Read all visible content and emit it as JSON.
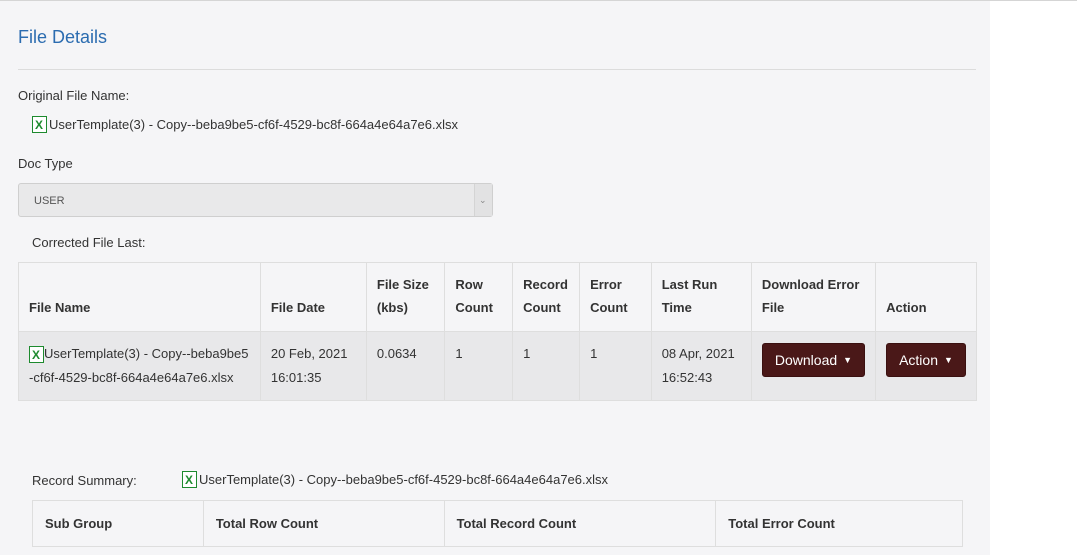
{
  "page": {
    "title": "File Details"
  },
  "original": {
    "label": "Original File Name:",
    "file_name": "UserTemplate(3) - Copy--beba9be5-cf6f-4529-bc8f-664a4e64a7e6.xlsx",
    "icon": "excel-file-icon"
  },
  "doc_type": {
    "label": "Doc Type",
    "selected": "USER",
    "icon": "chevron-down-icon"
  },
  "corrected": {
    "label": "Corrected File Last:",
    "columns": [
      "File Name",
      "File Date",
      "File Size(kbs)",
      "Row Count",
      "Record Count",
      "Error Count",
      "Last Run Time",
      "Download Error File",
      "Action"
    ],
    "row": {
      "file_name": "UserTemplate(3) - Copy--beba9be5-cf6f-4529-bc8f-664a4e64a7e6.xlsx",
      "file_date": "20 Feb, 2021 16:01:35",
      "file_size": "0.0634",
      "row_count": "1",
      "record_count": "1",
      "error_count": "1",
      "last_run": "08 Apr, 2021 16:52:43",
      "download_label": "Download",
      "action_label": "Action"
    }
  },
  "summary": {
    "label": "Record Summary:",
    "file_name": "UserTemplate(3) - Copy--beba9be5-cf6f-4529-bc8f-664a4e64a7e6.xlsx",
    "columns": [
      "Sub Group",
      "Total Row Count",
      "Total Record Count",
      "Total Error Count"
    ]
  },
  "colors": {
    "title": "#2b6cb0",
    "button": "#4a1818",
    "excel": "#1d8a2e"
  }
}
